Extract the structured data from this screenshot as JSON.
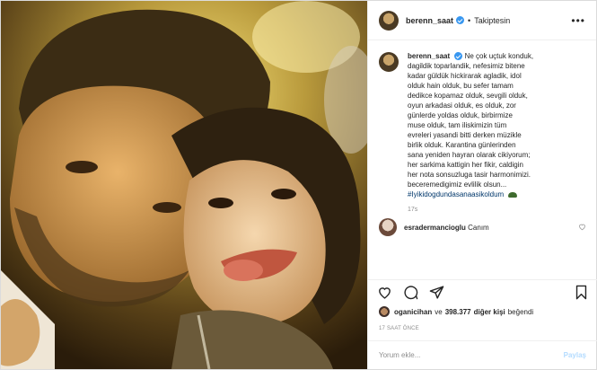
{
  "header": {
    "username": "berenn_saat",
    "separator": "•",
    "follow_status": "Takiptesin",
    "more_icon": "more-dots-icon"
  },
  "caption": {
    "username": "berenn_saat",
    "lines": [
      "Ne çok uçtuk konduk,",
      "dagildik toparlandik, nefesimiz bitene",
      "kadar güldük hickirarak agladik, idol",
      "olduk hain olduk, bu sefer tamam",
      "dedikce kopamaz olduk, sevgili olduk,",
      "oyun arkadasi olduk, es olduk, zor",
      "günlerde yoldas olduk, birbirmize",
      "muse olduk, tam iliskimizin tüm",
      "evreleri yasandi bitti derken müzikle",
      "birlik olduk. Karantina günlerinden",
      "sana yeniden hayran olarak cikiyorum;",
      "her sarkima kattigin her fikir, caldigin",
      "her nota sonsuzluga tasir harmonimizi.",
      "beceremedigimiz evlilik olsun..."
    ],
    "hashtag": "#Iyikidogdundasanaasikoldum",
    "time_ago": "17s"
  },
  "comment": {
    "username": "esradermancioglu",
    "text": "Canım"
  },
  "actions": {
    "icons": [
      "heart-icon",
      "comment-icon",
      "share-icon",
      "bookmark-icon"
    ]
  },
  "likes": {
    "user": "oganicihan",
    "connector": "ve",
    "count": "398.377",
    "rest": "diğer kişi",
    "suffix": "beğendi"
  },
  "timestamp": "17 SAAT ÖNCE",
  "add_comment": {
    "placeholder": "Yorum ekle...",
    "post_label": "Paylaş"
  },
  "colors": {
    "verified": "#3897f0",
    "hashtag": "#00376b",
    "muted": "#8e8e8e",
    "post_disabled": "#b3dbff"
  }
}
